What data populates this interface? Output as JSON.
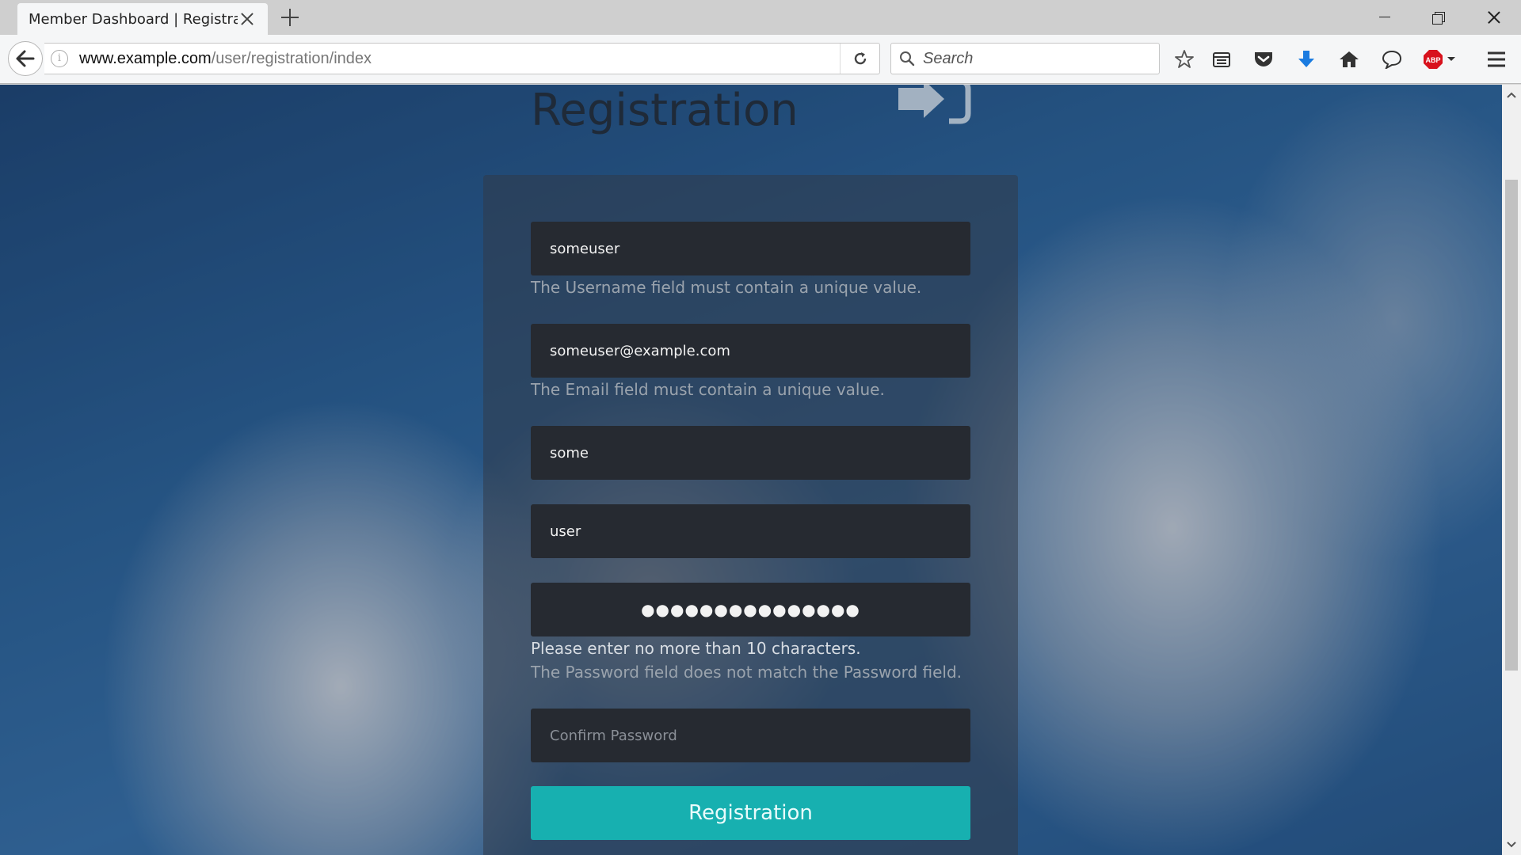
{
  "browser": {
    "tab_title": "Member Dashboard | Registra...",
    "url_host": "www.example.com",
    "url_path": "/user/registration/index",
    "search_placeholder": "Search"
  },
  "page": {
    "title": "Registration"
  },
  "form": {
    "username_value": "someuser",
    "username_error": "The Username field must contain a unique value.",
    "email_value": "someuser@example.com",
    "email_error": "The Email field must contain a unique value.",
    "first_name_value": "some",
    "last_name_value": "user",
    "password_value": "●●●●●●●●●●●●●●●",
    "password_error_length": "Please enter no more than 10 characters.",
    "password_error_match": "The Password field does not match the Password field.",
    "confirm_password_placeholder": "Confirm Password",
    "submit_label": "Registration"
  },
  "colors": {
    "accent": "#17b0b0",
    "field_bg": "#262a31"
  },
  "icons": [
    "back-arrow-icon",
    "info-icon",
    "reload-icon",
    "search-icon",
    "bookmark-star-icon",
    "reading-list-icon",
    "pocket-icon",
    "download-icon",
    "home-icon",
    "chat-icon",
    "adblock-icon",
    "menu-icon",
    "sign-in-icon"
  ]
}
